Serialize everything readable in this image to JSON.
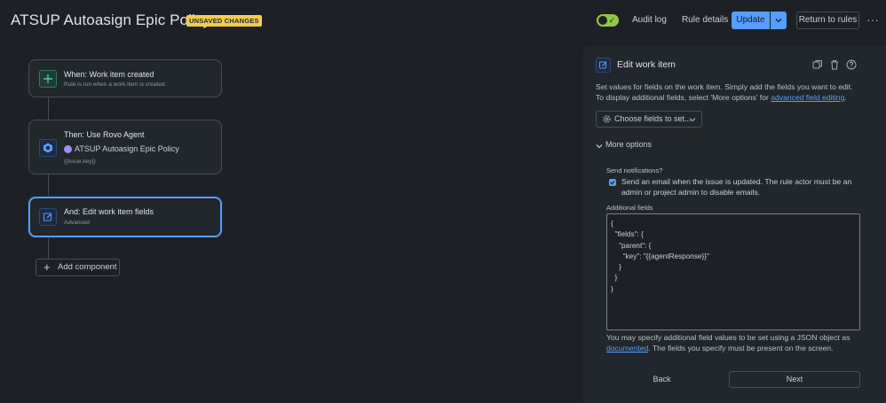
{
  "header": {
    "title": "ATSUP Autoasign Epic Policy",
    "badge": "UNSAVED CHANGES",
    "toggle_enabled": true,
    "audit_log": "Audit log",
    "rule_details": "Rule details",
    "update": "Update",
    "return_to_rules": "Return to rules",
    "more": "···"
  },
  "canvas": {
    "trigger": {
      "title": "When: Work item created",
      "subtitle": "Rule is run when a work item is created.",
      "icon": "plus-icon",
      "color": "#1f845a"
    },
    "action1": {
      "title": "Then: Use Rovo Agent",
      "agent_name": "ATSUP Autoasign Epic Policy",
      "subtitle": "{{issue.key}}",
      "icon": "rovo-agent-icon"
    },
    "action2": {
      "title": "And: Edit work item fields",
      "subtitle": "Advanced",
      "icon": "edit-icon"
    },
    "add_component": "Add component"
  },
  "panel": {
    "title": "Edit work item",
    "description_prefix": "Set values for fields on the work item. Simply add the fields you want to edit. To display additional fields, select 'More options' for ",
    "description_link": "advanced field editing",
    "description_suffix": ".",
    "choose_fields": "Choose fields to set...",
    "more_options": "More options",
    "send_notifications_label": "Send notifications?",
    "send_notifications_text": "Send an email when the issue is updated. The rule actor must be an admin or project admin to disable emails.",
    "send_notifications_checked": true,
    "additional_fields_label": "Additional fields",
    "additional_fields_value": "{\n  \"fields\": {\n    \"parent\": {\n      \"key\": \"{{agentResponse}}\"\n    }\n  }\n}",
    "help_prefix": "You may specify additional field values to be set using a JSON object as ",
    "help_link": "documented",
    "help_suffix": ". The fields you specify must be present on the screen.",
    "back": "Back",
    "next": "Next"
  },
  "colors": {
    "accent": "#579dff",
    "badge": "#f5cd47",
    "toggle": "#94c748"
  }
}
